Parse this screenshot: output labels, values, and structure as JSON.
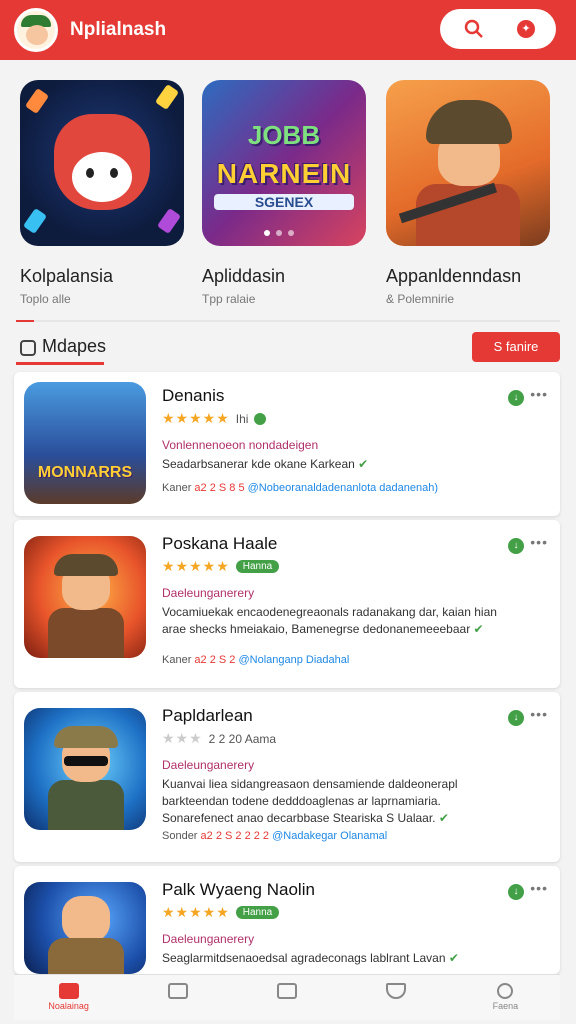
{
  "app": {
    "title": "Nplialnash"
  },
  "header": {
    "search_icon": "search-icon",
    "account_label": ""
  },
  "featured": [
    {
      "name": "Kolpalansia",
      "sub": "Toplo alle"
    },
    {
      "name": "Apliddasin",
      "sub": "Tpp ralaie"
    },
    {
      "name": "Appanldenndasn",
      "sub": "& Polemnirie"
    }
  ],
  "featured_art": {
    "game_word_top": "JOBB",
    "game_word": "NARNEIN",
    "game_word_sub": "SGENEX"
  },
  "section": {
    "title": "Mdapes",
    "button": "S fanire"
  },
  "cards": [
    {
      "title": "Denanis",
      "rating_text": "Ihi",
      "badge": "",
      "category": "Vonlennenoeon nondadeigen",
      "desc": "Seadarbsanerar kde okane Karkean",
      "meta_label": "Kaner",
      "meta_num": "a2 2 S 8 5",
      "meta_link": "@Nobeoranaldadenanlota dadanenah)",
      "thumb_word": "MONNARRS"
    },
    {
      "title": "Poskana Haale",
      "rating_text": "",
      "badge": "Hanna",
      "category": "Daeleunganerery",
      "desc": "Vocamiuekak encaodenegreaonals radanakang dar, kaian hian arae shecks hmeiakaio, Bamenegrse dedonanemeeebaar",
      "meta_label": "Kaner",
      "meta_num": "a2 2 S 2",
      "meta_link": "@Nolanganp Diadahal",
      "thumb_word": ""
    },
    {
      "title": "Papldarlean",
      "rating_text": "2 2 20 Aama",
      "badge": "",
      "category": "Daeleunganerery",
      "desc": "Kuanvai liea sidangreasaon densamiende daldeonerapl barkteendan todene dedddoaglenas ar laprnamiaria. Sonarefenect anao decarbbase Steariska S Ualaar.",
      "meta_label": "Sonder",
      "meta_num": "a2 2 S 2 2 2 2",
      "meta_link": "@Nadakegar Olanamal",
      "thumb_word": ""
    },
    {
      "title": "Palk Wyaeng Naolin",
      "rating_text": "",
      "badge": "Hanna",
      "category": "Daeleunganerery",
      "desc": "Seaglarmitdsenaoedsal agradeconags lablrant Lavan",
      "meta_label": "",
      "meta_num": "",
      "meta_link": "",
      "thumb_word": ""
    }
  ],
  "bottom_nav": [
    {
      "label": "Noalainag",
      "icon": "home-icon",
      "active": true
    },
    {
      "label": "",
      "icon": "inbox-icon",
      "active": false
    },
    {
      "label": "",
      "icon": "list-icon",
      "active": false
    },
    {
      "label": "",
      "icon": "triangle-icon",
      "active": false
    },
    {
      "label": "Faena",
      "icon": "search-icon",
      "active": false
    }
  ],
  "colors": {
    "brand_red": "#e53935",
    "star": "#f5a623",
    "green": "#43a047",
    "link": "#1e88e5"
  }
}
